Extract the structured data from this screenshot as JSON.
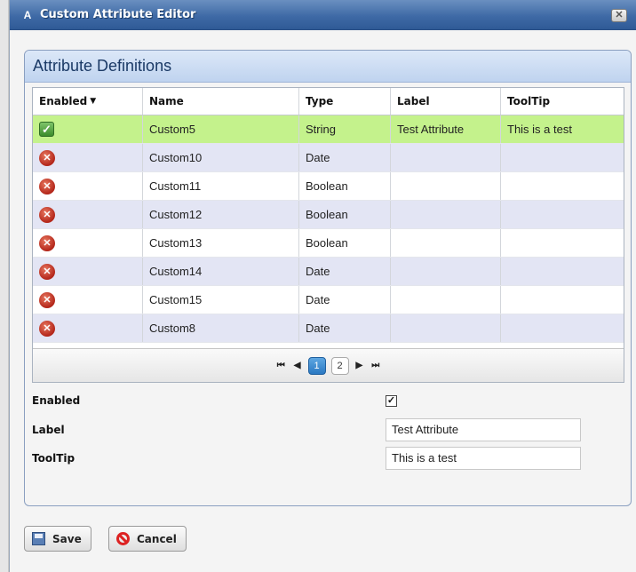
{
  "window": {
    "title": "Custom Attribute Editor",
    "close_label": "✕"
  },
  "panel": {
    "title": "Attribute Definitions"
  },
  "table": {
    "columns": [
      "Enabled",
      "Name",
      "Type",
      "Label",
      "ToolTip"
    ],
    "sort_icon": "sort-desc-icon",
    "rows": [
      {
        "enabled": true,
        "name": "Custom5",
        "type": "String",
        "label": "Test Attribute",
        "tooltip": "This is a test"
      },
      {
        "enabled": false,
        "name": "Custom10",
        "type": "Date",
        "label": "",
        "tooltip": ""
      },
      {
        "enabled": false,
        "name": "Custom11",
        "type": "Boolean",
        "label": "",
        "tooltip": ""
      },
      {
        "enabled": false,
        "name": "Custom12",
        "type": "Boolean",
        "label": "",
        "tooltip": ""
      },
      {
        "enabled": false,
        "name": "Custom13",
        "type": "Boolean",
        "label": "",
        "tooltip": ""
      },
      {
        "enabled": false,
        "name": "Custom14",
        "type": "Date",
        "label": "",
        "tooltip": ""
      },
      {
        "enabled": false,
        "name": "Custom15",
        "type": "Date",
        "label": "",
        "tooltip": ""
      },
      {
        "enabled": false,
        "name": "Custom8",
        "type": "Date",
        "label": "",
        "tooltip": ""
      }
    ],
    "selected_row": 0
  },
  "pager": {
    "pages": [
      "1",
      "2"
    ],
    "current_page": "1"
  },
  "form": {
    "enabled_label": "Enabled",
    "enabled_checked": true,
    "label_label": "Label",
    "label_value": "Test Attribute",
    "tooltip_label": "ToolTip",
    "tooltip_value": "This is a test"
  },
  "buttons": {
    "save": "Save",
    "cancel": "Cancel"
  },
  "colors": {
    "title_bar": "#3f6aa6",
    "selected_row": "#c4f28c",
    "alt_row": "#e3e5f4",
    "enabled_icon": "#3c8c2c",
    "disabled_icon": "#b3261a"
  }
}
